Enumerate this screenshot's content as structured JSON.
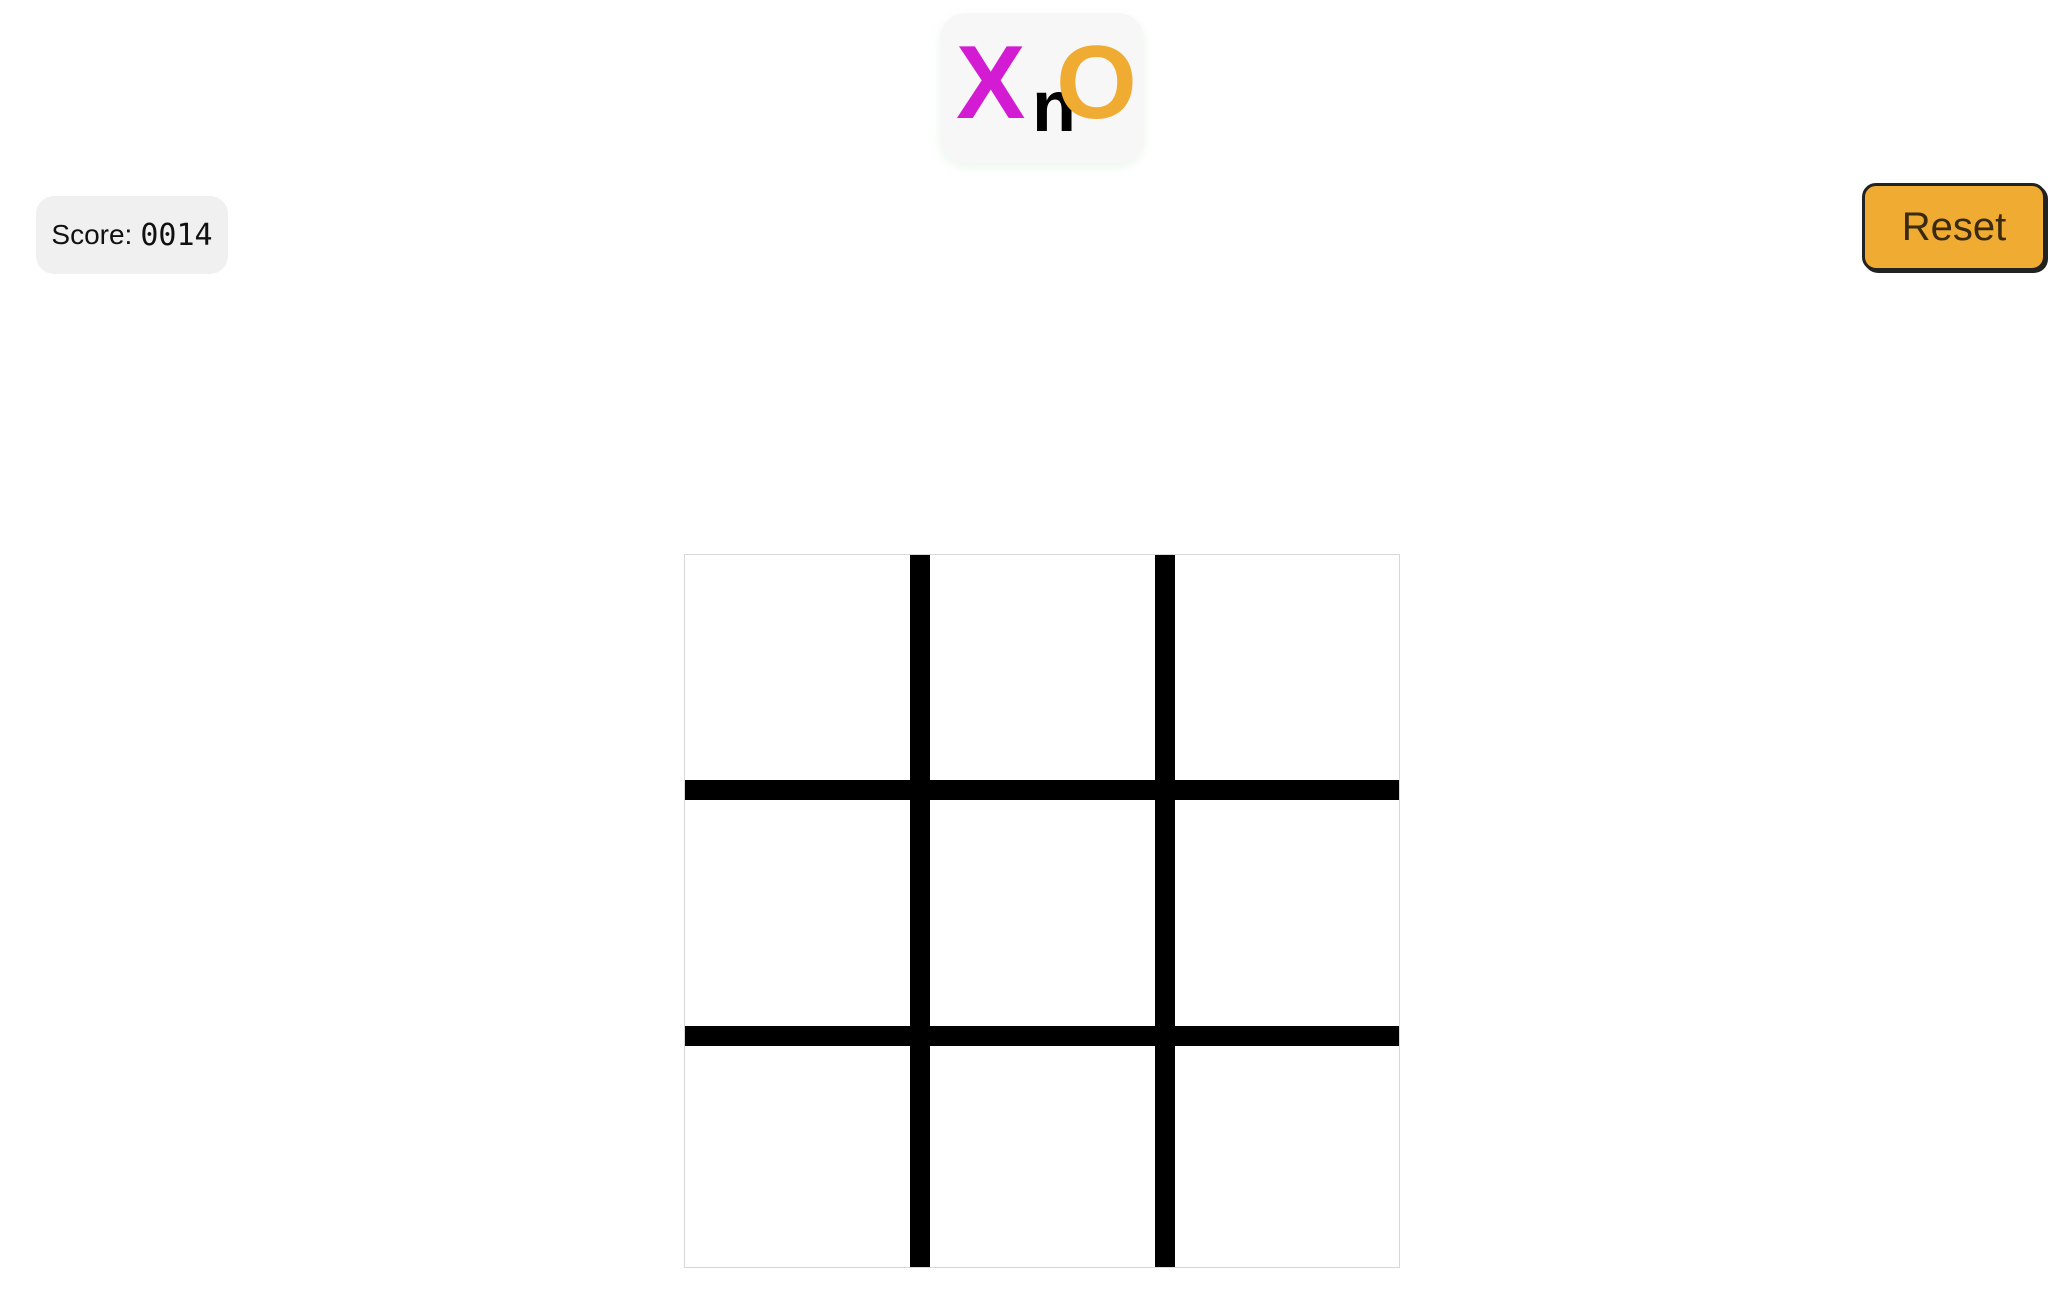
{
  "logo": {
    "x": "X",
    "n": "n",
    "o": "O",
    "x_color": "#d41bd4",
    "o_color": "#f0ab32"
  },
  "score": {
    "label": "Score:",
    "value": "0014"
  },
  "reset": {
    "label": "Reset",
    "color": "#f0ab32"
  },
  "board": {
    "cells": [
      "",
      "",
      "",
      "",
      "",
      "",
      "",
      "",
      ""
    ]
  }
}
